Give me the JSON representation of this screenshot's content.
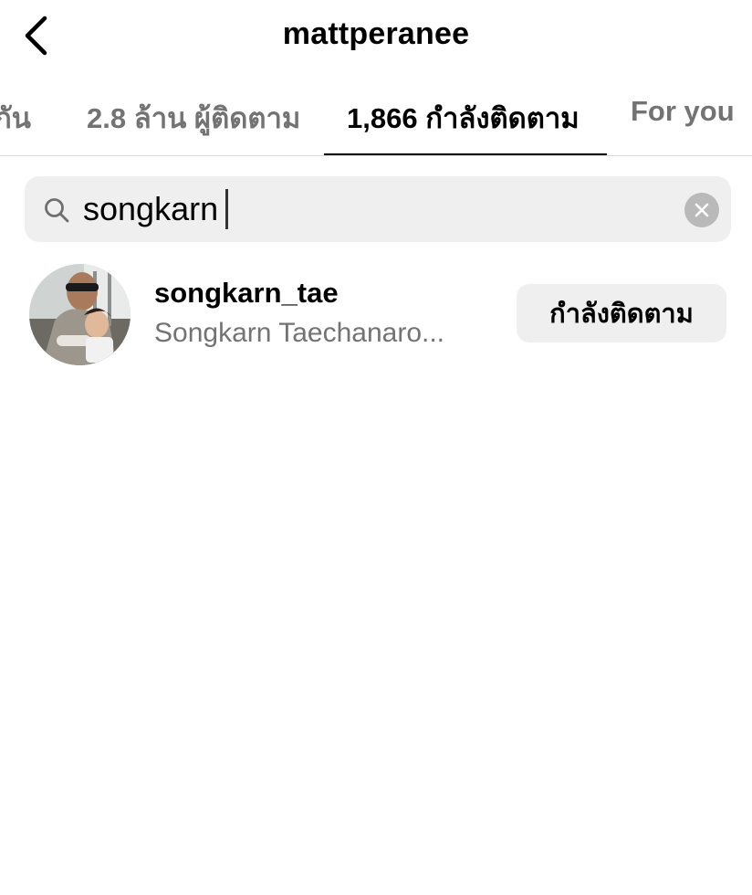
{
  "header": {
    "title": "mattperanee"
  },
  "tabs": [
    {
      "label": "กัน"
    },
    {
      "label": "2.8 ล้าน ผู้ติดตาม"
    },
    {
      "label": "1,866 กำลังติดตาม"
    },
    {
      "label": "For you"
    }
  ],
  "active_tab": 2,
  "search": {
    "value": "songkarn",
    "placeholder": ""
  },
  "results": [
    {
      "username": "songkarn_tae",
      "full_name": "Songkarn Taechanaro...",
      "button_label": "กำลังติดตาม"
    }
  ],
  "colors": {
    "background": "#ffffff",
    "secondary_text": "#737373",
    "search_bg": "#efefef",
    "divider": "#dbdbdb",
    "button_bg": "#efefef"
  },
  "icons": {
    "back": "chevron-left-icon",
    "search": "search-icon",
    "clear": "clear-icon"
  }
}
